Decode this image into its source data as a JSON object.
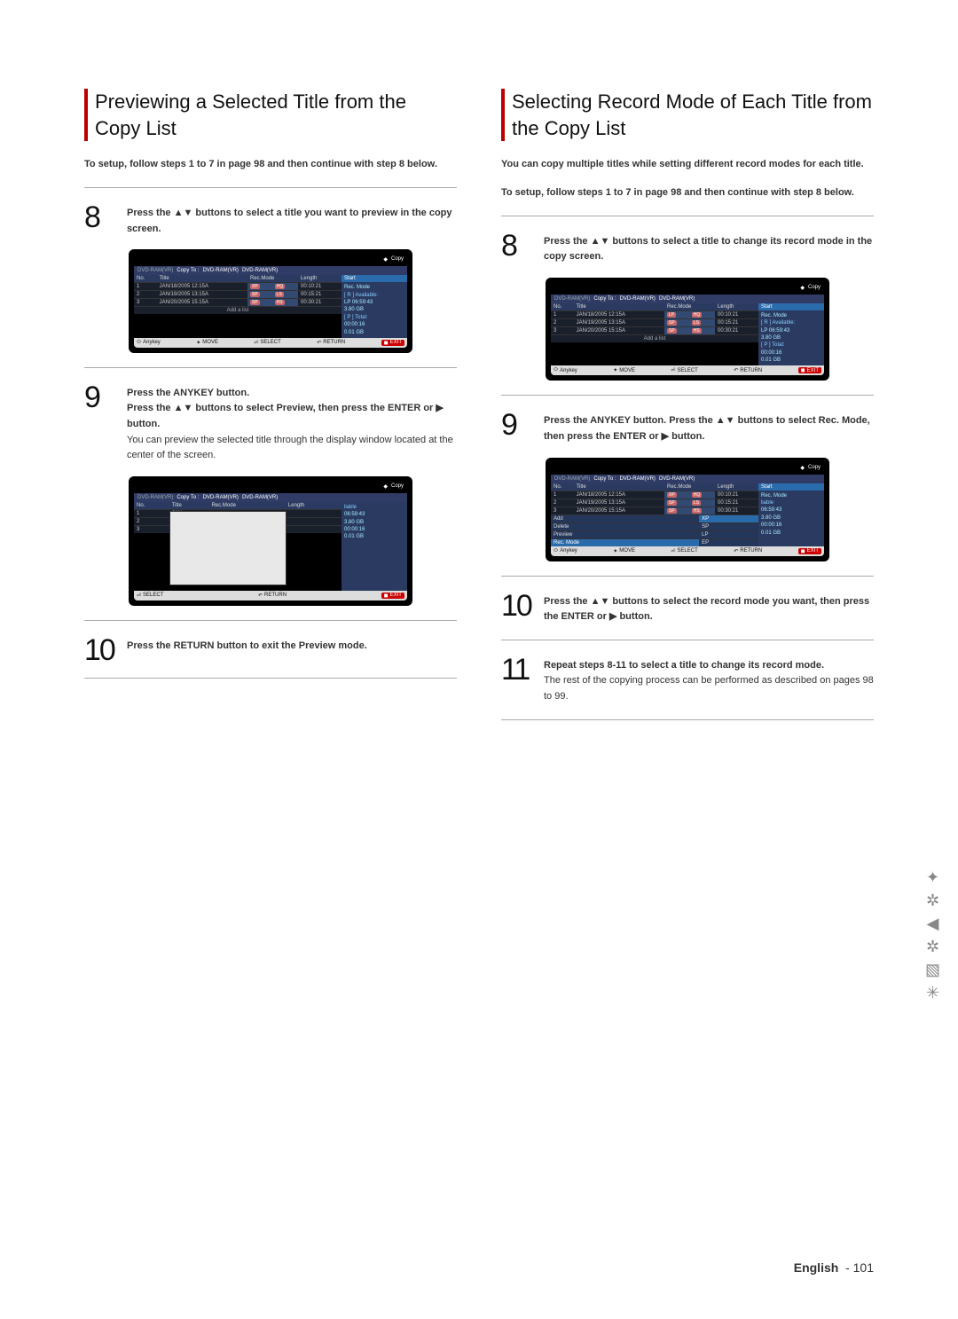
{
  "left": {
    "title": "Previewing a Selected Title from the Copy List",
    "lead": "To setup, follow steps 1 to 7 in page 98 and then continue with step 8 below.",
    "step8": "Press the ▲▼ buttons to select a title you want to preview in the copy screen.",
    "step9_a": "Press the ANYKEY button.",
    "step9_b": "Press the ▲▼ buttons to select Preview, then press the ENTER or ▶ button.",
    "step9_c": "You can preview the selected title through the display window located at the center of the screen.",
    "step10": "Press the RETURN button to exit the Preview mode."
  },
  "right": {
    "title": "Selecting Record Mode of Each Title from the Copy List",
    "lead1": "You can copy multiple titles while setting different record modes for each title.",
    "lead2": "To setup, follow steps 1 to 7 in page 98 and then continue with step 8 below.",
    "step8": "Press the ▲▼ buttons to select a title to change its record mode in the copy screen.",
    "step9": "Press the ANYKEY button. Press the ▲▼ buttons to select Rec. Mode, then press the ENTER or ▶ button.",
    "step10": "Press the ▲▼ buttons to select the record mode you want, then press the ENTER or ▶ button.",
    "step11_a": "Repeat steps 8-11 to select a title to change its record mode.",
    "step11_b": "The rest of the copying process can be performed as described on pages 98 to 99."
  },
  "shot": {
    "copy": "Copy",
    "src": "DVD-RAM(VR)",
    "arrow": "Copy To :",
    "dst1": "DVD-RAM(VR)",
    "dst2": "DVD-RAM(VR)",
    "cols": {
      "no": "No.",
      "title": "Title",
      "mode": "Rec.Mode",
      "len": "Length"
    },
    "rows": [
      {
        "no": "1",
        "title": "JAN/18/2005 12:15A",
        "m1": "XP",
        "m2": "HQ",
        "len": "00:10:21"
      },
      {
        "no": "2",
        "title": "JAN/19/2005 13:15A",
        "m1": "SP",
        "m2": "LS",
        "len": "00:15:21"
      },
      {
        "no": "3",
        "title": "JAN/20/2005 15:15A",
        "m1": "SP",
        "m2": "HS",
        "len": "00:30:21"
      }
    ],
    "rows2": [
      {
        "no": "1",
        "title": "JAN/18/2005 12:15A",
        "m1": "LP",
        "m2": "HQ",
        "len": "00:10:21"
      },
      {
        "no": "2",
        "title": "JAN/19/2005 13:15A",
        "m1": "SP",
        "m2": "LS",
        "len": "00:15:21"
      },
      {
        "no": "3",
        "title": "JAN/20/2005 15:15A",
        "m1": "SP",
        "m2": "HS",
        "len": "00:30:21"
      }
    ],
    "addlist": "Add a list",
    "side": {
      "start": "Start",
      "recmode": "Rec. Mode",
      "avail": "[ R ] Available:",
      "lp": "LP",
      "t1": "06:59:43",
      "g1": "3.80 GB",
      "total": "[ P ] Total:",
      "t2": "00:00:16",
      "g2": "0.01 GB"
    },
    "bar": {
      "anykey": "Anykey",
      "move": "MOVE",
      "select": "SELECT",
      "return": "RETURN",
      "exit": "EXIT"
    },
    "menu": {
      "add": "Add",
      "delete": "Delete",
      "preview": "Preview",
      "recmode": "Rec. Mode",
      "xp": "XP",
      "sp": "SP",
      "lp": "LP",
      "ep": "EP",
      "able": "liable"
    }
  },
  "footer": {
    "lang": "English",
    "page": "101"
  }
}
